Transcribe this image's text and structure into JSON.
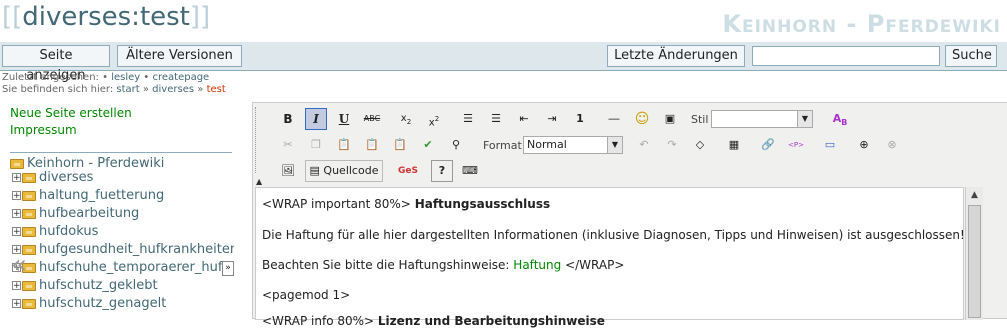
{
  "header": {
    "page_id": "diverses:test",
    "bracket_open": "[[",
    "bracket_close": "]]",
    "site_title": "Keinhorn - Pferdewiki"
  },
  "buttons": {
    "show_page": "Seite anzeigen",
    "older_versions": "Ältere Versionen",
    "recent_changes": "Letzte Änderungen",
    "search": "Suche"
  },
  "search": {
    "value": "",
    "placeholder": ""
  },
  "breadcrumbs": {
    "trace_label": "Zuletzt angesehen:",
    "trace_items": [
      "lesley",
      "createpage"
    ],
    "youarehere_label": "Sie befinden sich hier:",
    "path": [
      "start",
      "diverses",
      "test"
    ],
    "sep": "»",
    "bullet": "•"
  },
  "sidebar": {
    "links": [
      "Neue Seite erstellen",
      "Impressum"
    ],
    "tree_root": "Keinhorn - Pferdewiki",
    "tree_items": [
      "diverses",
      "haltung_fuetterung",
      "hufbearbeitung",
      "hufdokus",
      "hufgesundheit_hufkrankheiten",
      "hufschuhe_temporaerer_hufschutz",
      "hufschutz_geklebt",
      "hufschutz_genagelt"
    ]
  },
  "editor": {
    "toolbar": {
      "style_label": "Stil",
      "style_value": "",
      "format_label": "Format",
      "format_value": "Normal",
      "source_label": "Quellcode"
    },
    "content": {
      "line1_markup": "<WRAP important 80%>",
      "line1_bold": "Haftungsausschluss",
      "line2": "Die Haftung für alle hier dargestellten Informationen (inklusive Diagnosen, Tipps und Hinweisen) ist ausgeschlossen!",
      "line3_pre": "Beachten Sie bitte die Haftungshinweise:",
      "line3_link": "Haftung",
      "line3_post": "</WRAP>",
      "line4": "<pagemod 1>",
      "line5_markup": "<WRAP info 80%>",
      "line5_bold": "Lizenz und Bearbeitungshinweise"
    }
  },
  "colors": {
    "link": "#436976",
    "sidebar_link": "#008800",
    "bar_bg": "#dee7ec",
    "border": "#8cacbb"
  },
  "icons": [
    "bold-icon",
    "italic-icon",
    "underline-icon",
    "strikethrough-icon",
    "subscript-icon",
    "superscript-icon",
    "ordered-list-icon",
    "unordered-list-icon",
    "outdent-icon",
    "indent-icon",
    "code-icon",
    "horizontal-rule-icon",
    "smiley-icon",
    "plugin-icon",
    "style-icon",
    "cut-icon",
    "copy-icon",
    "paste-icon",
    "paste-text-icon",
    "paste-word-icon",
    "spellcheck-icon",
    "find-icon",
    "undo-icon",
    "redo-icon",
    "eraser-icon",
    "table-icon",
    "link-icon",
    "html-icon",
    "image-box-icon",
    "wikilink-icon",
    "unlink-icon",
    "image-icon",
    "source-icon",
    "geshi-icon",
    "help-icon",
    "keyboard-icon"
  ]
}
